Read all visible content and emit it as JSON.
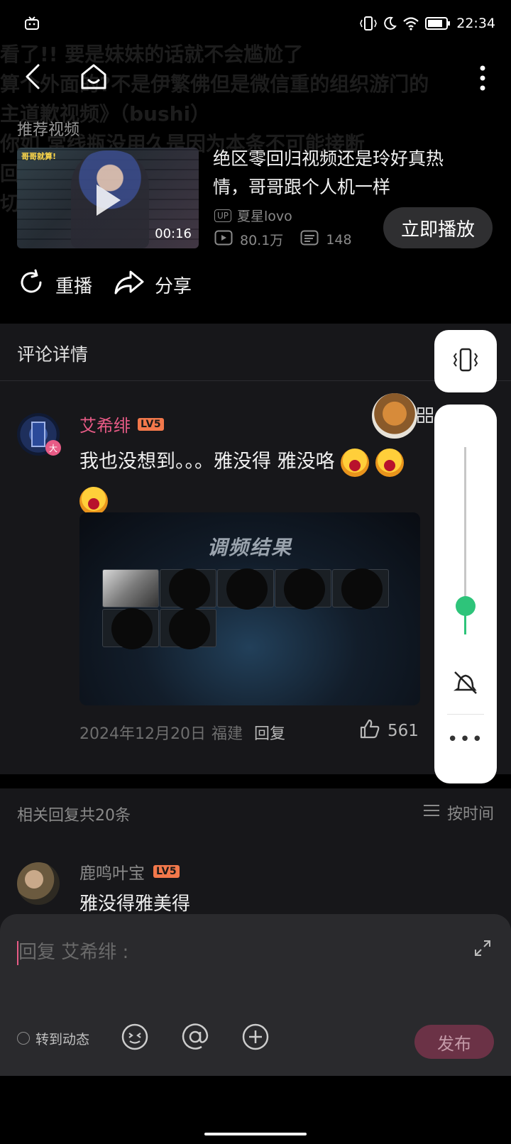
{
  "status_bar": {
    "time": "22:34",
    "icons": [
      "tv-icon",
      "vibrate-icon",
      "moon-icon",
      "wifi-icon",
      "battery-icon"
    ]
  },
  "background_ghost": [
    "看了!!    要是妹妹的话就不会尴尬了",
    "算个外面的?不是伊繁佛但是微信重的组织游门的",
    "主道歉视频》（bushi）",
    "你如    常线瓶没用久是因为本条不可能接断",
    "回复            好",
    "切换"
  ],
  "header": {
    "back_icon": "back-arrow-icon",
    "home_icon": "home-icon",
    "more_icon": "more-vertical-icon"
  },
  "recommend": {
    "label": "推荐视频",
    "thumb_caption": "哥哥就算!",
    "duration": "00:16",
    "title": "绝区零回归视频还是玲好真热情，哥哥跟个人机一样",
    "up_tag": "UP",
    "author": "夏星lovo",
    "views": "80.1万",
    "danmaku": "148",
    "play_now": "立即播放"
  },
  "actions": {
    "replay": "重播",
    "share": "分享"
  },
  "comment": {
    "panel_title": "评论详情",
    "author": "艾希绯",
    "level": "LV5",
    "badge": "大",
    "text": "我也没想到。。。雅没得 雅没咯",
    "image_title": "调频结果",
    "date": "2024年12月20日",
    "location": "福建",
    "reply": "回复",
    "likes": "561"
  },
  "replies": {
    "header": "相关回复共20条",
    "sort": "按时间",
    "items": [
      {
        "author": "鹿鸣叶宝",
        "level": "LV5",
        "text": "雅没得雅美得"
      }
    ]
  },
  "composer": {
    "placeholder": "回复 艾希绯 :",
    "repost": "转到动态",
    "publish": "发布"
  },
  "volume": {
    "level": 0.15,
    "accent": "#2ec47a"
  },
  "colors": {
    "accent_pink": "#e85b86",
    "level_orange": "#f2784b",
    "background": "#000000",
    "panel": "#17171a"
  }
}
